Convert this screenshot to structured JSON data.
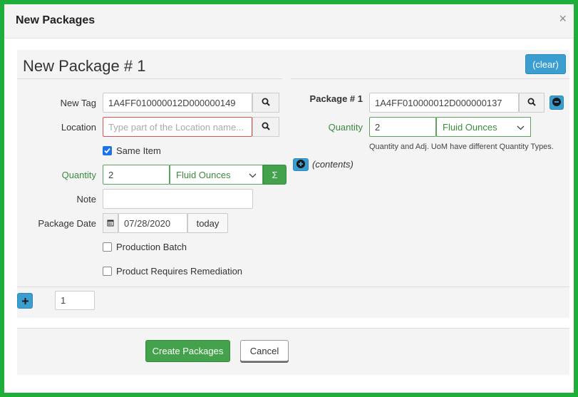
{
  "dialog": {
    "title": "New Packages",
    "close_glyph": "×"
  },
  "form": {
    "heading": "New Package # 1",
    "clear_label": "(clear)",
    "new_tag": {
      "label": "New Tag",
      "value": "1A4FF010000012D000000149"
    },
    "location": {
      "label": "Location",
      "placeholder": "Type part of the Location name..."
    },
    "same_item": {
      "label": "Same Item",
      "checked": true
    },
    "quantity": {
      "label": "Quantity",
      "value": "2",
      "unit": "Fluid Ounces",
      "sum_glyph": "Σ"
    },
    "note": {
      "label": "Note",
      "value": ""
    },
    "package_date": {
      "label": "Package Date",
      "value": "07/28/2020",
      "today_label": "today"
    },
    "production_batch": {
      "label": "Production Batch",
      "checked": false
    },
    "requires_remediation": {
      "label": "Product Requires Remediation",
      "checked": false
    },
    "add_count": "1"
  },
  "source_package": {
    "label": "Package # 1",
    "tag": "1A4FF010000012D000000137",
    "quantity_label": "Quantity",
    "quantity_value": "2",
    "unit": "Fluid Ounces",
    "warning": "Quantity and Adj. UoM have different Quantity Types.",
    "contents_label": "(contents)"
  },
  "footer": {
    "create_label": "Create Packages",
    "cancel_label": "Cancel"
  },
  "colors": {
    "frame": "#1fae3a",
    "info": "#3a9fd0",
    "green": "#43a24b"
  }
}
